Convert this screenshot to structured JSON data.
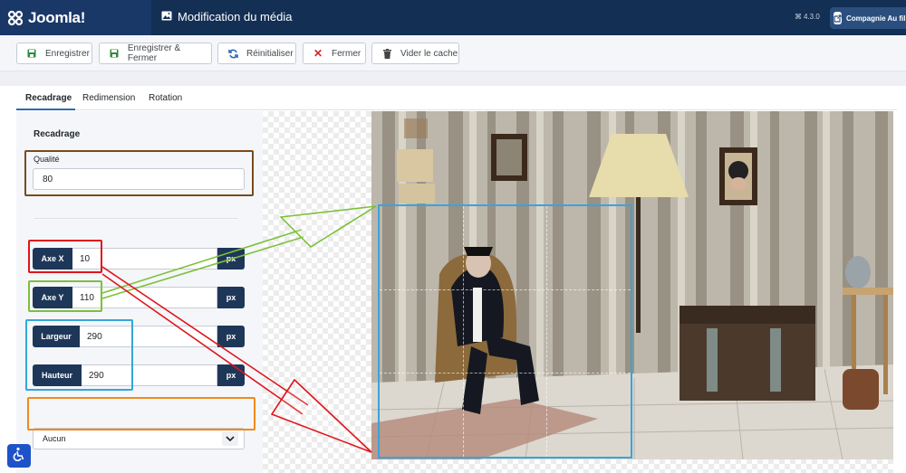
{
  "header": {
    "logo_text": "Joomla!",
    "title": "Modification du média",
    "version": "4.3.0",
    "site_button": "Compagnie Au fil de"
  },
  "toolbar": {
    "save": "Enregistrer",
    "save_close": "Enregistrer & Fermer",
    "reset": "Réinitialiser",
    "close": "Fermer",
    "clear_cache": "Vider le cache"
  },
  "tabs": [
    {
      "label": "Recadrage",
      "active": true
    },
    {
      "label": "Redimension",
      "active": false
    },
    {
      "label": "Rotation",
      "active": false
    }
  ],
  "crop": {
    "section_label": "Recadrage",
    "quality_label": "Qualité",
    "quality_value": "80",
    "x_label": "Axe X",
    "x_value": "10",
    "y_label": "Axe Y",
    "y_value": "110",
    "width_label": "Largeur",
    "width_value": "290",
    "height_label": "Hauteur",
    "height_value": "290",
    "unit": "px",
    "ratio_selected": "Aucun"
  },
  "colors": {
    "header_bg": "#132f53",
    "label_bg": "#1e3759",
    "crop_box": "#3aa3dd",
    "highlight_quality": "#7a4b1c",
    "highlight_x": "#e0141b",
    "highlight_y": "#7cc03a",
    "highlight_size": "#34a6d8",
    "highlight_ratio": "#f08a1c"
  }
}
